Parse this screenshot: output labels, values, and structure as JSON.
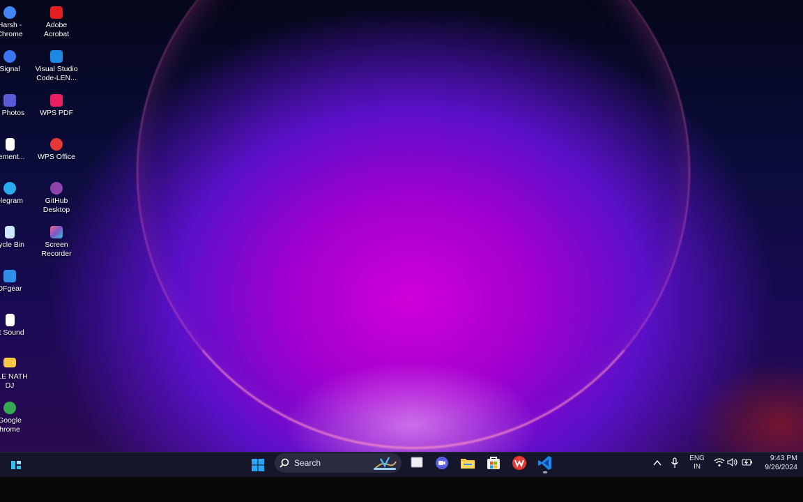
{
  "desktop": {
    "left_column": [
      {
        "label": "Harsh -\nChrome",
        "icon": "chrome-icon",
        "color": "#4285f4"
      },
      {
        "label": "Signal",
        "icon": "signal-icon",
        "color": "#3a76f0"
      },
      {
        "label": "S Photos",
        "icon": "photos-icon",
        "color": "#5b5bd6"
      },
      {
        "label": "cement...",
        "icon": "document-icon",
        "color": "#ffffff"
      },
      {
        "label": "elegram",
        "icon": "telegram-icon",
        "color": "#2aabee"
      },
      {
        "label": "cycle Bin",
        "icon": "recycle-bin-icon",
        "color": "#cfe6ff"
      },
      {
        "label": "DFgear",
        "icon": "pdfgear-icon",
        "color": "#2f8fe8"
      },
      {
        "label": "st Sound",
        "icon": "sound-file-icon",
        "color": "#ffffff"
      },
      {
        "label": "OLE NATH\nDJ",
        "icon": "folder-icon",
        "color": "#f7c948"
      },
      {
        "label": "Google\nhrome",
        "icon": "chrome-icon",
        "color": "#34a853"
      }
    ],
    "right_column": [
      {
        "label": "Adobe\nAcrobat",
        "icon": "adobe-acrobat-icon",
        "color": "#e41e1e"
      },
      {
        "label": "Visual Studio\nCode-LEN...",
        "icon": "vscode-icon",
        "color": "#1e88e5"
      },
      {
        "label": "WPS PDF",
        "icon": "wps-pdf-icon",
        "color": "#e91e63"
      },
      {
        "label": "WPS Office",
        "icon": "wps-office-icon",
        "color": "#e53935"
      },
      {
        "label": "GitHub\nDesktop",
        "icon": "github-desktop-icon",
        "color": "#8e44ad"
      },
      {
        "label": "Screen\nRecorder",
        "icon": "screen-recorder-icon",
        "color": "#d53b9b"
      }
    ]
  },
  "taskbar": {
    "search_label": "Search",
    "apps": [
      {
        "name": "start-button",
        "icon": "windows-logo-icon",
        "color": "#2aa4f4"
      },
      {
        "name": "task-view-button",
        "icon": "task-view-icon",
        "color": "#e0e0e0"
      },
      {
        "name": "meet-button",
        "icon": "meet-icon",
        "color": "#5b5fe8"
      },
      {
        "name": "file-explorer-button",
        "icon": "folder-icon",
        "color": "#f7c948"
      },
      {
        "name": "store-button",
        "icon": "store-icon",
        "color": "#3aa0f0"
      },
      {
        "name": "wps-office-button",
        "icon": "wps-office-icon",
        "color": "#e53935"
      },
      {
        "name": "vscode-button",
        "icon": "vscode-icon",
        "color": "#1e88e5"
      }
    ],
    "widgets_icon": "widgets-icon",
    "tray": {
      "lang_top": "ENG",
      "lang_bottom": "IN",
      "time": "9:43 PM",
      "date": "9/26/2024"
    }
  }
}
